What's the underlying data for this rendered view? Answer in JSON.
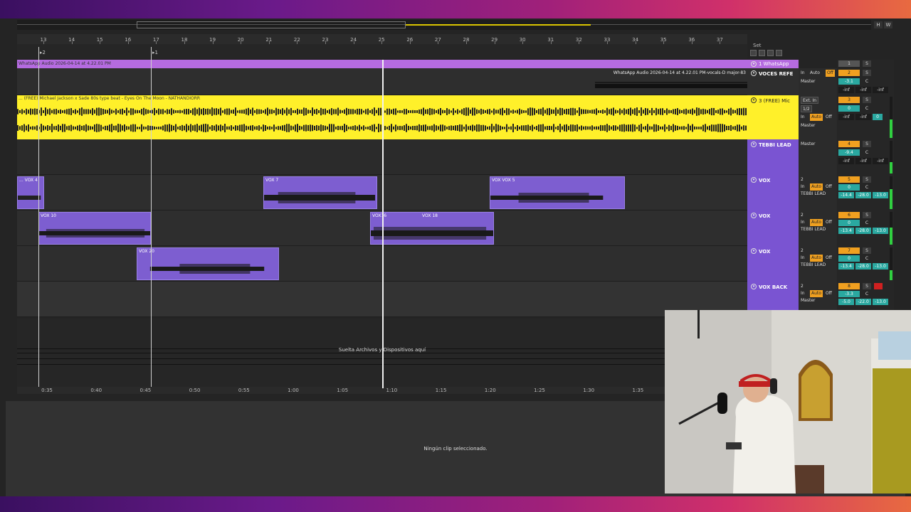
{
  "ruler": {
    "bars": [
      "13",
      "14",
      "15",
      "16",
      "17",
      "18",
      "19",
      "20",
      "21",
      "22",
      "23",
      "24",
      "25",
      "26",
      "27",
      "28",
      "29",
      "30",
      "31",
      "32",
      "33",
      "34",
      "35",
      "36",
      "37"
    ]
  },
  "locators": {
    "loc1": "2",
    "loc2": "1"
  },
  "set_label": "Set",
  "overview_buttons": {
    "h": "H",
    "w": "W"
  },
  "tracks": [
    {
      "name": "1 WhatsApp",
      "clip_title": "WhatsApp Audio 2026-04-14 at 4.22.01 PM",
      "io": {
        "input": "In",
        "auto": "Auto",
        "off": "Off",
        "out": "Master"
      },
      "mixer": {
        "number": "1"
      }
    },
    {
      "name": "VOCES REFE",
      "clip_title": "WhatsApp Audio 2026-04-14 at 4.22.01 PM-vocals-D major-83",
      "io": {
        "input": "In",
        "auto": "Auto",
        "off": "Off",
        "out": "Master"
      },
      "mixer": {
        "number": "2",
        "vol": "-3.1",
        "left": "-inf",
        "right": "-inf",
        "right2": "-inf"
      }
    },
    {
      "name": "3 (FREE) Mic",
      "clip_title": "... (FREE) Michael Jackson x Sade 80s type beat - Eyes On The Moon - NATHANDIORR",
      "io": {
        "input": "Ext. In",
        "ch": "1/2",
        "in2": "In",
        "auto": "Auto",
        "off": "Off",
        "out": "Master"
      },
      "mixer": {
        "number": "3",
        "vol": "0",
        "pan": "C",
        "left": "-inf",
        "right": "-inf",
        "val": "0"
      }
    },
    {
      "name": "TEBBI LEAD",
      "io": {
        "out": "Master"
      },
      "mixer": {
        "number": "4",
        "vol": "-9.4",
        "pan": "C",
        "left": "-inf",
        "mid": "-inf",
        "right": "-inf"
      }
    },
    {
      "name": "VOX",
      "io": {
        "ch": "2",
        "input": "In",
        "auto": "Auto",
        "off": "Off",
        "out": "TEBBI LEAD"
      },
      "mixer": {
        "number": "5",
        "vol": "0",
        "pan": "C",
        "a": "-14.4",
        "b": "-28.0",
        "c": "-13.0"
      }
    },
    {
      "name": "VOX",
      "io": {
        "ch": "2",
        "input": "In",
        "auto": "Auto",
        "off": "Off",
        "out": "TEBBI LEAD"
      },
      "mixer": {
        "number": "6",
        "vol": "0",
        "pan": "C",
        "a": "-13.4",
        "b": "-28.0",
        "c": "-13.0"
      }
    },
    {
      "name": "VOX",
      "io": {
        "ch": "2",
        "input": "In",
        "auto": "Auto",
        "off": "Off",
        "out": "TEBBI LEAD"
      },
      "mixer": {
        "number": "7",
        "vol": "0",
        "pan": "C",
        "a": "-13.4",
        "b": "-28.0",
        "c": "-13.0"
      }
    },
    {
      "name": "VOX BACK",
      "io": {
        "ch": "2",
        "input": "In",
        "auto": "Auto",
        "off": "Off",
        "out": "Master"
      },
      "mixer": {
        "number": "8",
        "vol": "-3.3",
        "pan": "C",
        "a": "-5.0",
        "b": "-22.0",
        "c": "-13.0"
      }
    }
  ],
  "clips": {
    "vox4": "... VOX 4",
    "vox7": "VOX 7",
    "vox_vox5": "VOX  VOX 5",
    "vox10": "VOX 10",
    "vox16": "VOX16",
    "vox18": "VOX 18",
    "vox20": "VOX 20"
  },
  "mixer_labels": {
    "s": "S",
    "c": "C"
  },
  "drop_text": "Suelta Archivos y Dispositivos aquí",
  "timebar": [
    "0:35",
    "0:40",
    "0:45",
    "0:50",
    "0:55",
    "1:00",
    "1:05",
    "1:10",
    "1:15",
    "1:20",
    "1:25",
    "1:30",
    "1:35"
  ],
  "detail_text": "Ningún clip seleccionado.",
  "colors": {
    "purple_clip": "#7d5ed0",
    "yellow_clip": "#ffee1a",
    "header_purple": "#7a54d2",
    "accent_orange": "#f0a020"
  }
}
